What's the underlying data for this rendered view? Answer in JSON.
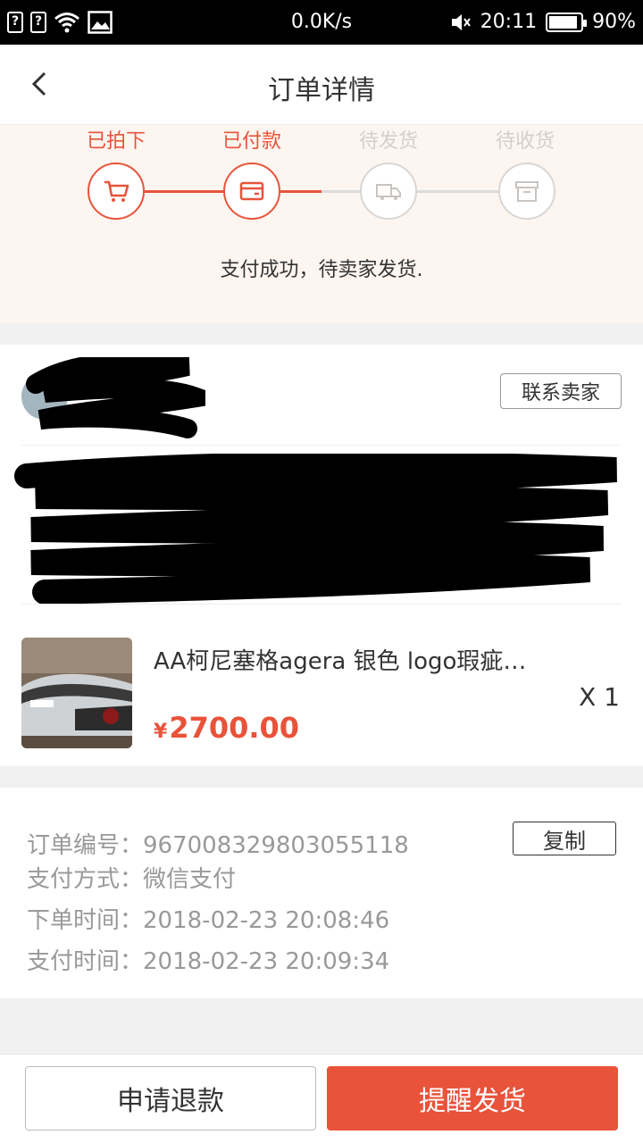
{
  "status_bar": {
    "network_speed": "0.0K/s",
    "time": "20:11",
    "battery": "90%",
    "battery_level": 0.9
  },
  "header": {
    "title": "订单详情",
    "back_icon": "chevron-left-icon"
  },
  "progress": {
    "steps": [
      {
        "label": "已拍下",
        "icon": "cart-icon",
        "active": true
      },
      {
        "label": "已付款",
        "icon": "card-icon",
        "active": true
      },
      {
        "label": "待发货",
        "icon": "truck-icon",
        "active": false
      },
      {
        "label": "待收货",
        "icon": "box-icon",
        "active": false
      }
    ],
    "message": "支付成功，待卖家发货."
  },
  "seller": {
    "contact_label": "联系卖家"
  },
  "product": {
    "title": "AA柯尼塞格agera 银色 logo瑕疵…",
    "currency": "¥",
    "price": "2700.00",
    "quantity": "X 1"
  },
  "order_info": {
    "rows": [
      {
        "label": "订单编号：",
        "value": "967008329803055118"
      },
      {
        "label": "支付方式：",
        "value": "微信支付"
      },
      {
        "label": "下单时间：",
        "value": "2018-02-23 20:08:46"
      },
      {
        "label": "支付时间：",
        "value": "2018-02-23 20:09:34"
      }
    ],
    "copy_label": "复制"
  },
  "actions": {
    "refund_label": "申请退款",
    "remind_label": "提醒发货"
  },
  "colors": {
    "accent": "#e8533a",
    "inactive": "#d9d6d3",
    "progress_bg": "#fdf5f0"
  }
}
